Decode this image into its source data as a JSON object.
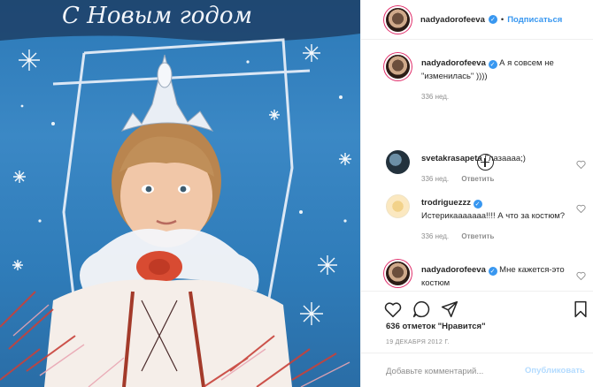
{
  "post": {
    "username": "nadyadorofeeva",
    "follow_label": "Подписаться",
    "dot": "•",
    "verified_mark": "✓",
    "photo_greeting": "С Новым годом"
  },
  "comments": [
    {
      "username": "nadyadorofeeva",
      "text": "А я совсем не \"изменилась\" ))))",
      "time": "336 нед.",
      "verified": true,
      "is_caption": true
    },
    {
      "username": "svetakrasapeta",
      "text": "Глазаааа;)",
      "time": "336 нед.",
      "reply": "Ответить",
      "verified": false
    },
    {
      "username": "trodriguezzz",
      "text": "Истерикааааааа!!!! А что за костюм?",
      "time": "336 нед.",
      "reply": "Ответить",
      "verified": true
    },
    {
      "username": "nadyadorofeeva",
      "text": "Мне кажется-это костюм",
      "verified": true
    }
  ],
  "actions": {
    "icons": [
      "heart-icon",
      "comment-icon",
      "share-icon",
      "bookmark-icon"
    ],
    "likes": "636 отметок \"Нравится\"",
    "date": "19 ДЕКАБРЯ 2012 Г."
  },
  "composer": {
    "placeholder": "Добавьте комментарий...",
    "publish_label": "Опубликовать"
  },
  "colors": {
    "accent": "#3897f0",
    "publish_disabled": "#b3dbff",
    "meta_text": "#8e8e8e",
    "photo_blue": "#2f7cb9"
  }
}
